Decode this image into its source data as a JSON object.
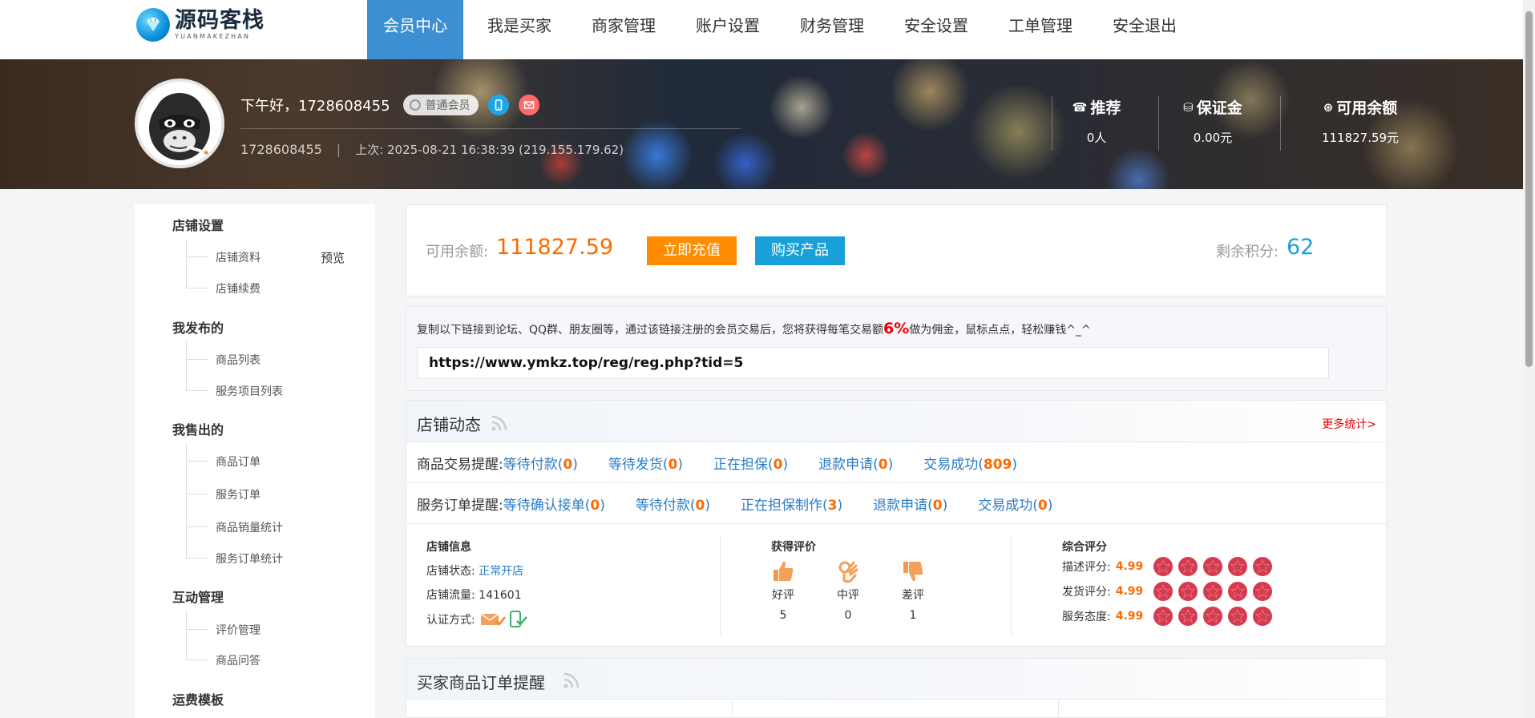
{
  "logo": {
    "title": "源码客栈",
    "subtitle": "YUANMAKEZHAN"
  },
  "nav": [
    "会员中心",
    "我是买家",
    "商家管理",
    "账户设置",
    "财务管理",
    "安全设置",
    "工单管理",
    "安全退出"
  ],
  "nav_active": 0,
  "user": {
    "greeting": "下午好，1728608455",
    "member_level": "普通会员",
    "username": "1728608455",
    "last_login": "上次: 2025-08-21 16:38:39 (219.155.179.62)"
  },
  "stats": [
    {
      "label": "推荐",
      "value": "0人",
      "icon": "phone-icon"
    },
    {
      "label": "保证金",
      "value": "0.00元",
      "icon": "coin-icon"
    },
    {
      "label": "可用余额",
      "value": "111827.59元",
      "icon": "balance-icon"
    }
  ],
  "sidebar": {
    "groups": [
      {
        "title": "店铺设置",
        "items": [
          "店铺资料",
          "店铺续费"
        ]
      },
      {
        "title": "我发布的",
        "items": [
          "商品列表",
          "服务项目列表"
        ]
      },
      {
        "title": "我售出的",
        "items": [
          "商品订单",
          "服务订单",
          "商品销量统计",
          "服务订单统计"
        ]
      },
      {
        "title": "互动管理",
        "items": [
          "评价管理",
          "商品问答"
        ]
      },
      {
        "title": "运费模板",
        "items": []
      }
    ],
    "preview_label": "预览"
  },
  "balance": {
    "label": "可用余额:",
    "value": "111827.59",
    "recharge_label": "立即充值",
    "buy_label": "购买产品",
    "points_label": "剩余积分:",
    "points_value": "62"
  },
  "referral": {
    "text_before": "复制以下链接到论坛、QQ群、朋友圈等，通过该链接注册的会员交易后，您将获得每笔交易额",
    "percent": "6%",
    "text_after": "做为佣金，鼠标点点，轻松赚钱^_^",
    "link": "https://www.ymkz.top/reg/reg.php?tid=5"
  },
  "dynamics": {
    "title": "店铺动态",
    "more_label": "更多统计>",
    "goods_row": {
      "label": "商品交易提醒:",
      "items": [
        {
          "name": "等待付款",
          "count": "0"
        },
        {
          "name": "等待发货",
          "count": "0"
        },
        {
          "name": "正在担保",
          "count": "0"
        },
        {
          "name": "退款申请",
          "count": "0"
        },
        {
          "name": "交易成功",
          "count": "809"
        }
      ]
    },
    "service_row": {
      "label": "服务订单提醒:",
      "items": [
        {
          "name": "等待确认接单",
          "count": "0"
        },
        {
          "name": "等待付款",
          "count": "0"
        },
        {
          "name": "正在担保制作",
          "count": "3"
        },
        {
          "name": "退款申请",
          "count": "0"
        },
        {
          "name": "交易成功",
          "count": "0"
        }
      ]
    },
    "shop_info": {
      "title": "店铺信息",
      "status_label": "店铺状态:",
      "status_value": "正常开店",
      "traffic_label": "店铺流量:",
      "traffic_value": "141601",
      "cert_label": "认证方式:"
    },
    "reviews": {
      "title": "获得评价",
      "items": [
        {
          "label": "好评",
          "count": "5",
          "icon": "thumbs-up-icon"
        },
        {
          "label": "中评",
          "count": "0",
          "icon": "ok-hand-icon"
        },
        {
          "label": "差评",
          "count": "1",
          "icon": "thumbs-down-icon"
        }
      ]
    },
    "scores": {
      "title": "综合评分",
      "items": [
        {
          "label": "描述评分:",
          "value": "4.99",
          "stars": 5
        },
        {
          "label": "发货评分:",
          "value": "4.99",
          "stars": 5
        },
        {
          "label": "服务态度:",
          "value": "4.99",
          "stars": 5
        }
      ]
    }
  },
  "buyer": {
    "title": "买家商品订单提醒"
  },
  "colors": {
    "nav_active": "#3d8fd4",
    "orange": "#ff6a00",
    "blue": "#1aa0d8",
    "link": "#2a7bc4",
    "red": "#e00000",
    "star": "#d63a4f"
  }
}
